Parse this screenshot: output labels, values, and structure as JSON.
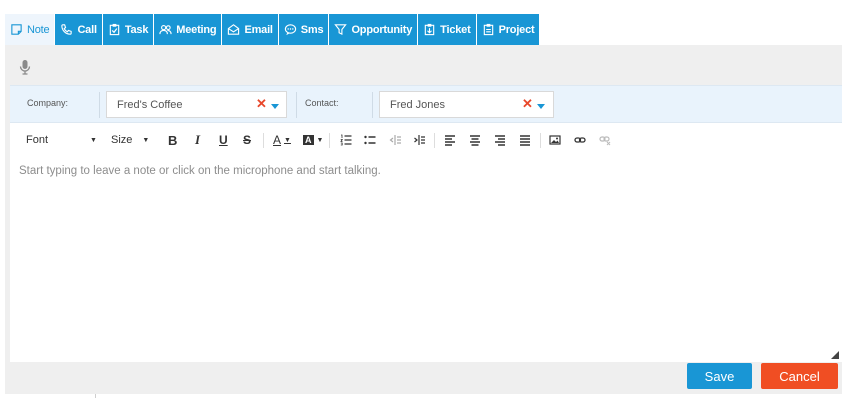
{
  "tabs": [
    {
      "label": "Note",
      "icon": "note-icon",
      "active": true
    },
    {
      "label": "Call",
      "icon": "phone-icon"
    },
    {
      "label": "Task",
      "icon": "clipboard-check-icon"
    },
    {
      "label": "Meeting",
      "icon": "people-icon"
    },
    {
      "label": "Email",
      "icon": "envelope-icon"
    },
    {
      "label": "Sms",
      "icon": "chat-bubble-icon"
    },
    {
      "label": "Opportunity",
      "icon": "funnel-icon"
    },
    {
      "label": "Ticket",
      "icon": "ticket-icon"
    },
    {
      "label": "Project",
      "icon": "clipboard-list-icon"
    }
  ],
  "fields": {
    "company_label": "Company:",
    "company_value": "Fred's Coffee",
    "contact_label": "Contact:",
    "contact_value": "Fred Jones"
  },
  "toolbar": {
    "font_label": "Font",
    "size_label": "Size",
    "bold": "B",
    "italic": "I",
    "underline": "U",
    "strike": "S",
    "text_color": "A",
    "bg_color": "A"
  },
  "editor": {
    "placeholder": "Start typing to leave a note or click on the microphone and start talking."
  },
  "actions": {
    "save_label": "Save",
    "cancel_label": "Cancel"
  },
  "colors": {
    "accent": "#1996d5",
    "cancel": "#f04e23",
    "clear_x": "#e8472a"
  }
}
